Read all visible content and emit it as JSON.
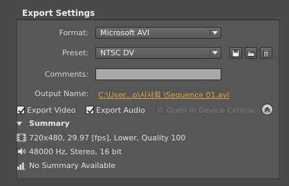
{
  "panel": {
    "title": "Export Settings"
  },
  "form": {
    "format_label": "Format:",
    "format_value": "Microsoft AVI",
    "preset_label": "Preset:",
    "preset_value": "NTSC DV",
    "comments_label": "Comments:",
    "comments_value": "",
    "output_label": "Output Name:",
    "output_value": "C:\\User...p\\시사회 \\Sequence 01.avi"
  },
  "options": {
    "export_video": {
      "label": "Export Video",
      "checked": true
    },
    "export_audio": {
      "label": "Export Audio",
      "checked": true
    },
    "open_device_central": {
      "label": "Open in Device Central",
      "checked": false,
      "enabled": false
    }
  },
  "summary": {
    "title": "Summary",
    "video": "720x480, 29.97 [fps], Lower, Quality 100",
    "audio": "48000 Hz, Stereo, 16 bit",
    "bitrate": "No Summary Available"
  },
  "icons": {
    "save_preset": "save-preset-icon",
    "import_preset": "folder-icon",
    "delete_preset": "trash-icon",
    "collapse": "chevron-up-icon",
    "video_summary": "film-icon",
    "audio_summary": "speaker-icon",
    "bitrate_summary": "bars-icon"
  },
  "colors": {
    "link": "#e8a63a",
    "panel_bg": "#575757",
    "field_bg": "#a9a9a9"
  }
}
